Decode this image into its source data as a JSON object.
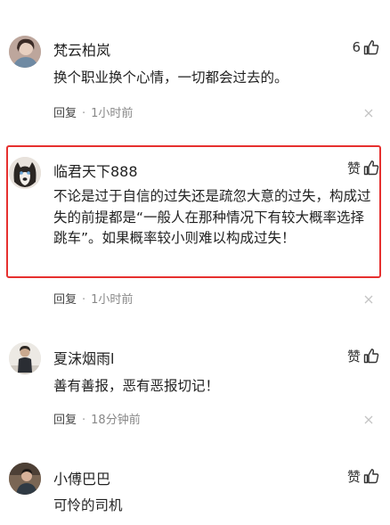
{
  "comments": [
    {
      "username": "梵云柏岚",
      "like": "6",
      "content": "换个职业换个心情，一切都会过去的。",
      "reply": "回复",
      "separator": "·",
      "time": "1小时前"
    },
    {
      "username": "临君天下888",
      "like": "赞",
      "content": "不论是过于自信的过失还是疏忽大意的过失，构成过失的前提都是“一般人在那种情况下有较大概率选择跳车”。如果概率较小则难以构成过失！",
      "reply": "回复",
      "separator": "·",
      "time": "1小时前"
    },
    {
      "username": "夏沫烟雨l",
      "like": "赞",
      "content": "善有善报，恶有恶报切记！",
      "reply": "回复",
      "separator": "·",
      "time": "18分钟前"
    },
    {
      "username": "小傅巴巴",
      "like": "赞",
      "content": "可怜的司机"
    }
  ],
  "colors": {
    "highlight_border": "#e6302f",
    "text": "#222222",
    "meta": "#888888"
  },
  "icons": {
    "like": "thumbs-up-icon",
    "close": "close-icon"
  }
}
